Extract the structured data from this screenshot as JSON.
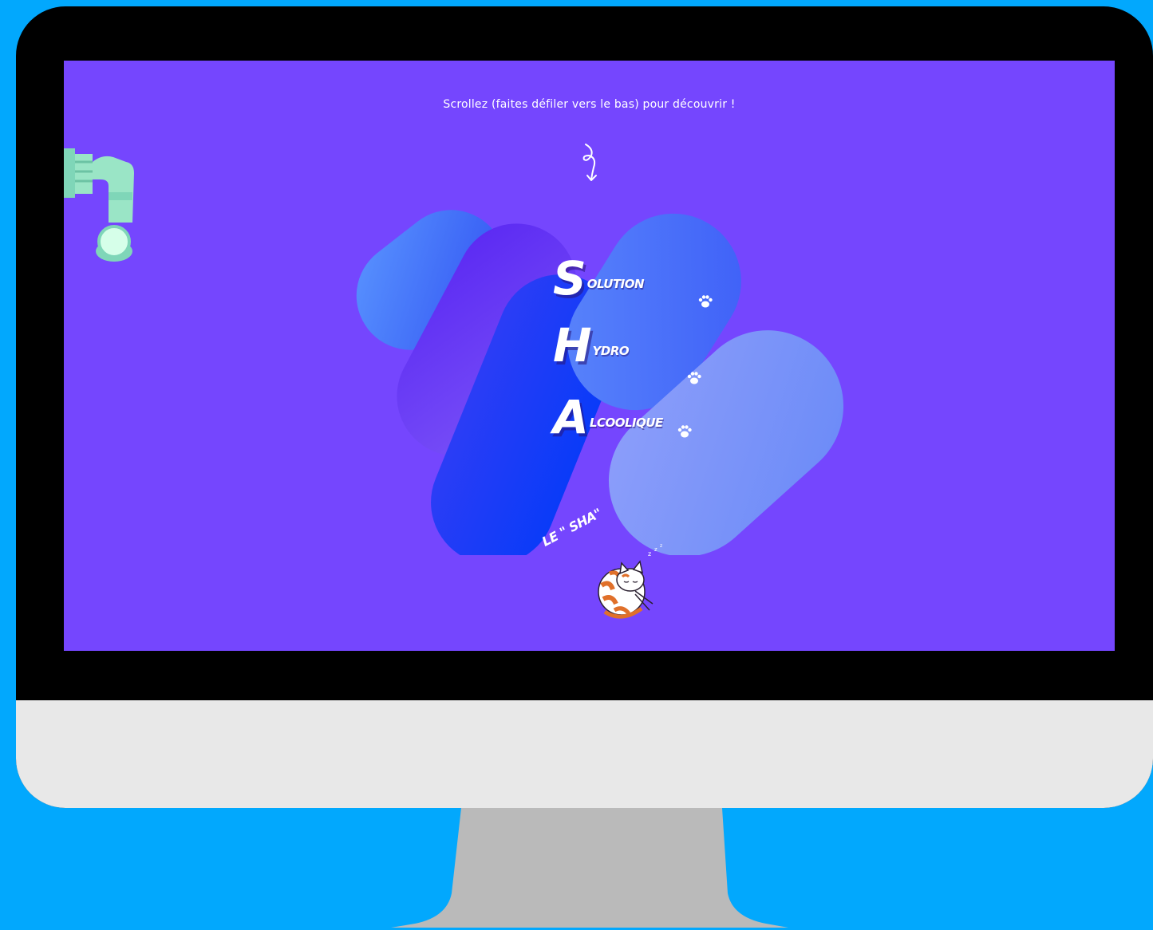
{
  "screen": {
    "scroll_hint": "Scrollez (faites défiler vers le bas) pour découvrir !",
    "acronym": [
      {
        "letter": "S",
        "rest": "OLUTION"
      },
      {
        "letter": "H",
        "rest": "YDRO"
      },
      {
        "letter": "A",
        "rest": "LCOOLIQUE"
      }
    ],
    "tagline": "LE \" SHA\""
  },
  "icons": [
    "arrow-down-icon",
    "faucet-icon",
    "paw-icon",
    "cat-icon"
  ],
  "colors": {
    "outer_background": "#02a8fd",
    "bezel": "#000000",
    "chin": "#e8e8e8",
    "stand": "#bababa",
    "screen_background": "#7546fe"
  }
}
